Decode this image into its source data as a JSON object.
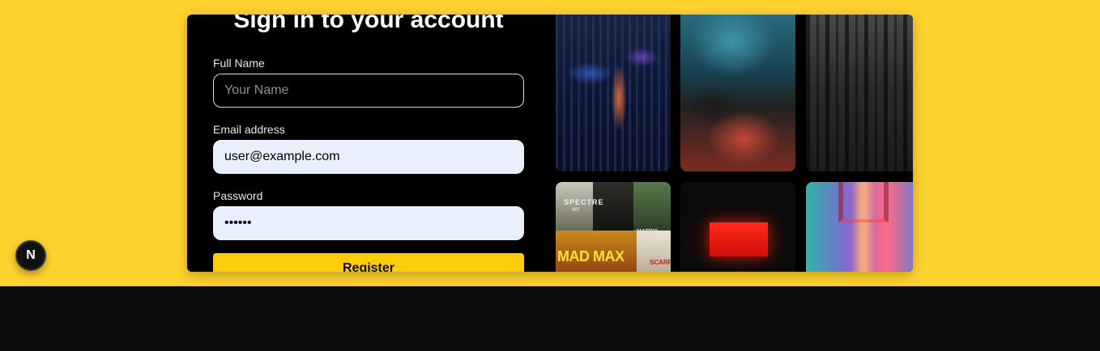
{
  "form": {
    "title": "Sign in to your account",
    "full_name": {
      "label": "Full Name",
      "placeholder": "Your Name",
      "value": ""
    },
    "email": {
      "label": "Email address",
      "value": "user@example.com"
    },
    "password": {
      "label": "Password",
      "value": "••••••"
    },
    "submit_label": "Register"
  },
  "gallery": {
    "posters": {
      "spectre": "SPECTRE",
      "bond": "007",
      "matrix": "MATRIX",
      "madmax": "MAD MAX",
      "scarface": "SCARF"
    }
  },
  "dev_badge": {
    "letter": "N"
  },
  "colors": {
    "background_band": "#fdd22f",
    "card": "#000000",
    "button": "#fdcc0a",
    "autofill": "#e8f0fe",
    "page_bottom": "#0b0b0b"
  },
  "icons": [
    "next-js-dev-indicator-icon"
  ]
}
